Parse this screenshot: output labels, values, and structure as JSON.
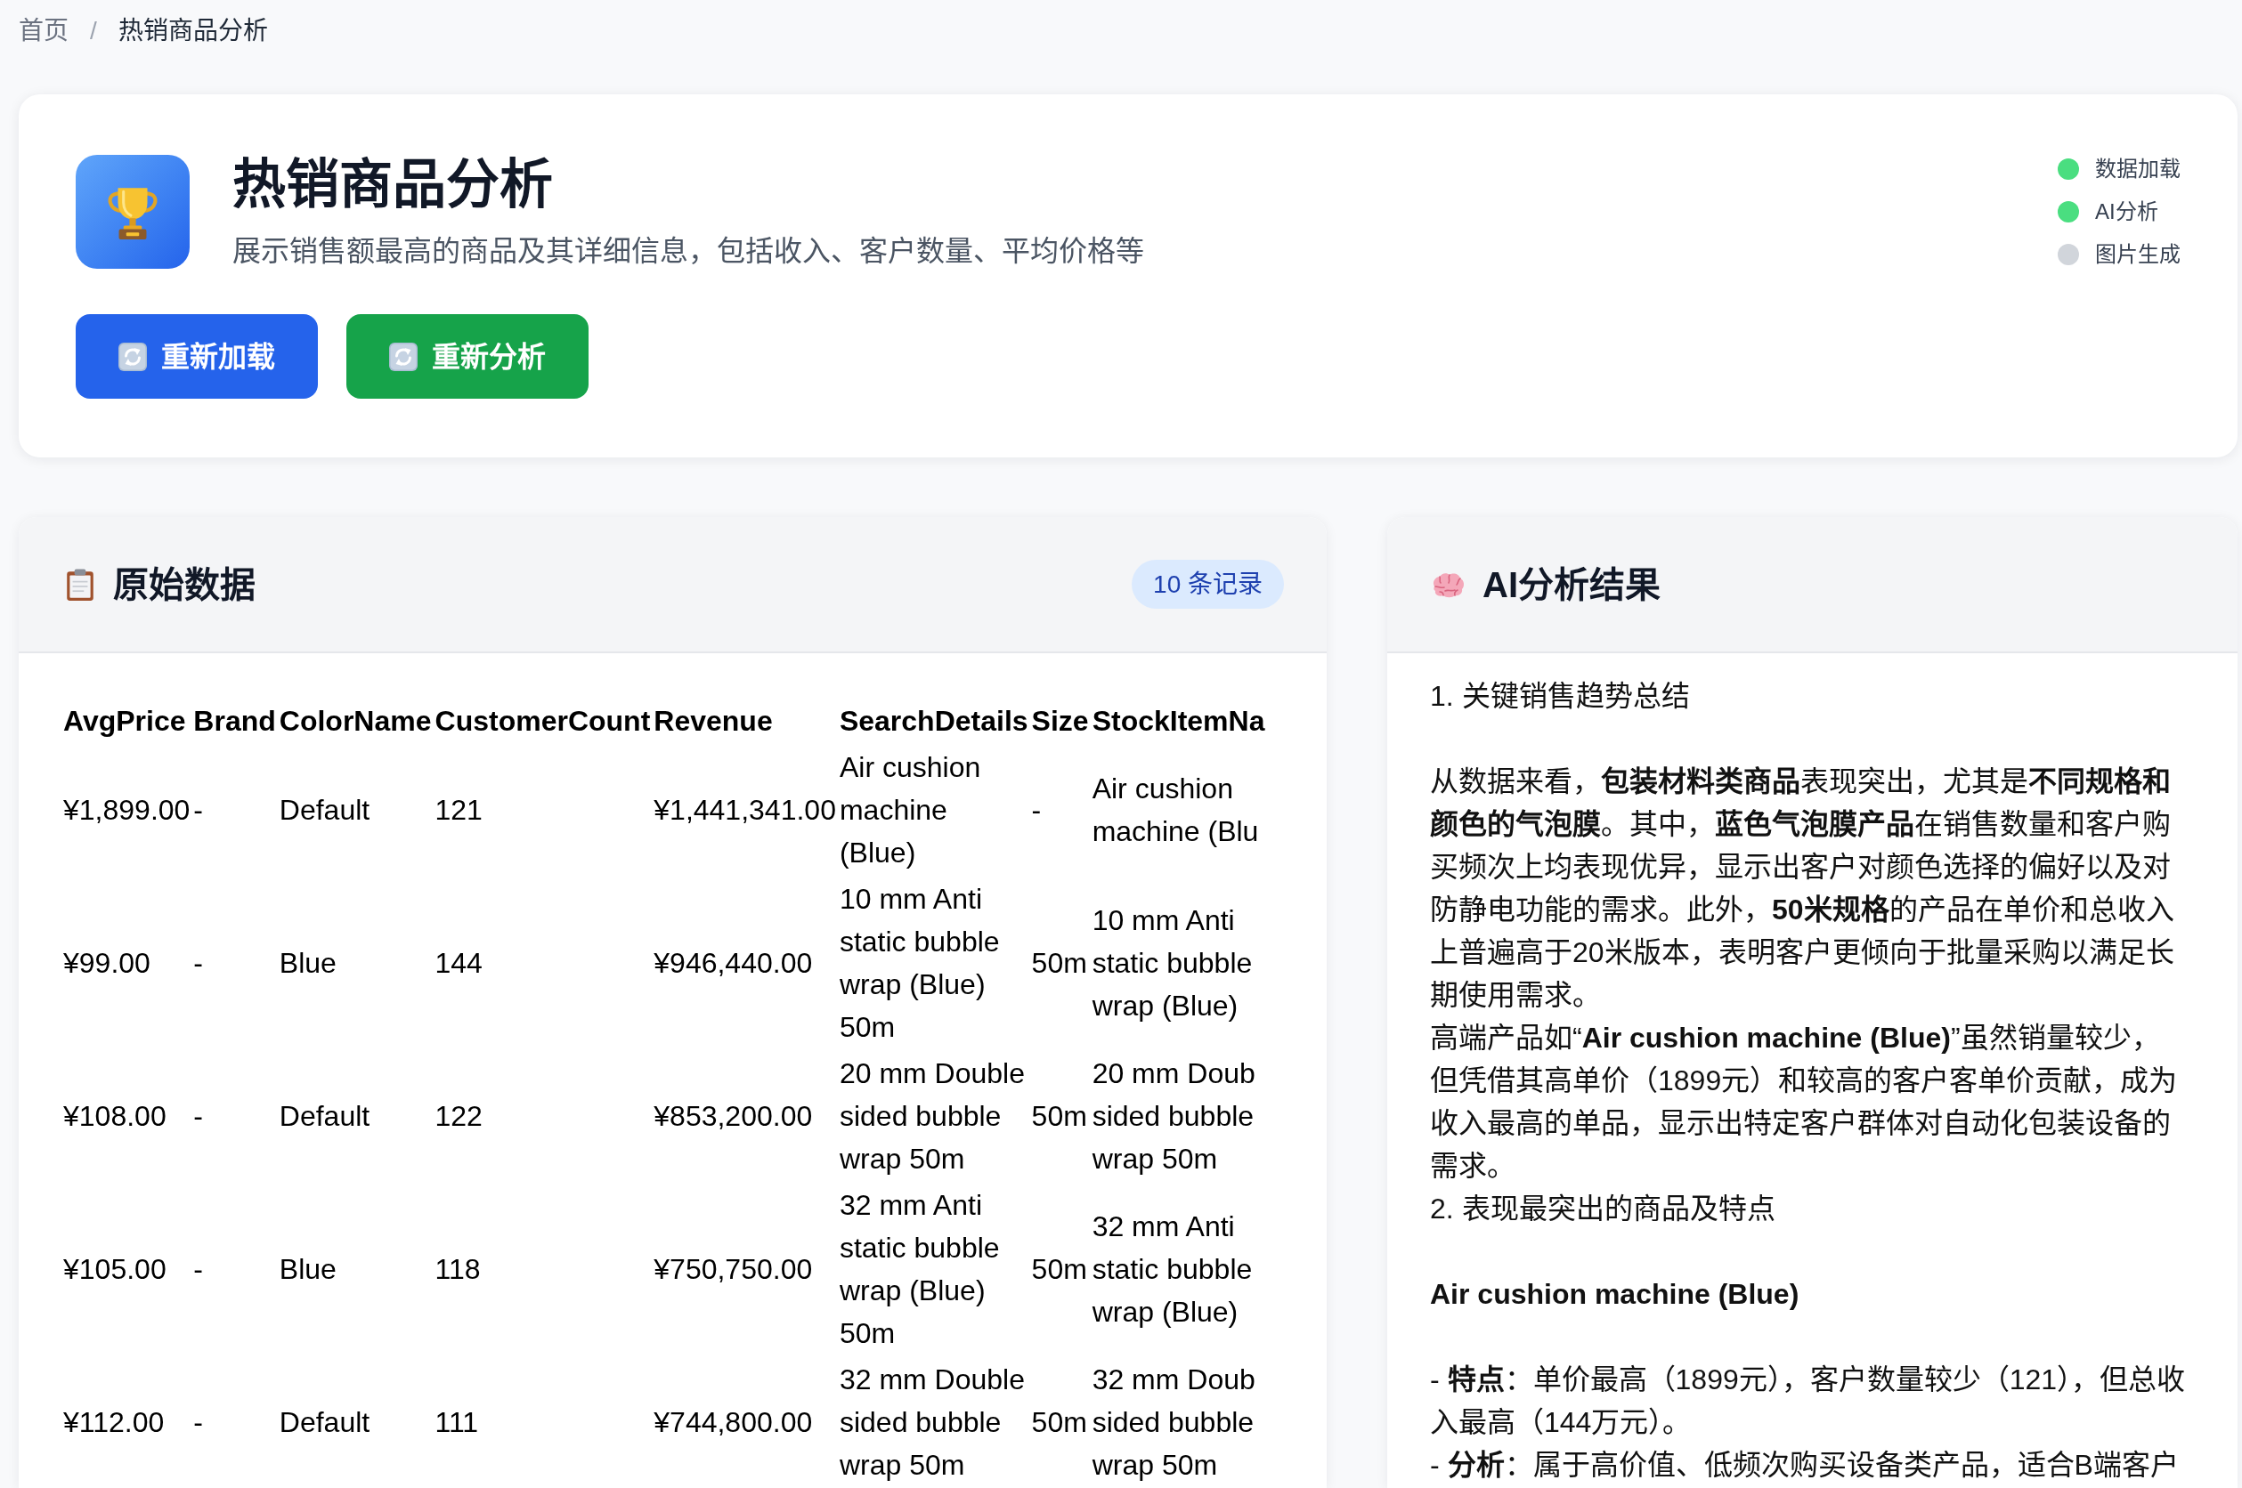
{
  "breadcrumb": {
    "separator": "/",
    "items": [
      {
        "label": "首页",
        "current": false
      },
      {
        "label": "热销商品分析",
        "current": true
      }
    ]
  },
  "header": {
    "title": "热销商品分析",
    "subtitle": "展示销售额最高的商品及其详细信息，包括收入、客户数量、平均价格等",
    "buttons": [
      {
        "label": "重新加载",
        "color": "#2563eb"
      },
      {
        "label": "重新分析",
        "color": "#16a34a"
      }
    ],
    "steps": [
      {
        "label": "数据加载",
        "color": "#4ade80"
      },
      {
        "label": "AI分析",
        "color": "#4ade80"
      },
      {
        "label": "图片生成",
        "color": "#d1d5db"
      }
    ]
  },
  "raw_data": {
    "title": "原始数据",
    "badge": "10 条记录",
    "table": {
      "columns": [
        "AvgPrice",
        "Brand",
        "ColorName",
        "CustomerCount",
        "Revenue",
        "SearchDetails",
        "Size",
        "StockItemNa"
      ],
      "rows": [
        [
          "¥1,899.00",
          "-",
          "Default",
          "121",
          "¥1,441,341.00",
          "Air cushion machine (Blue)",
          "-",
          "Air cushion machine (Blu"
        ],
        [
          "¥99.00",
          "-",
          "Blue",
          "144",
          "¥946,440.00",
          "10 mm Anti static bubble wrap (Blue) 50m",
          "50m",
          "10 mm Anti static bubble wrap (Blue)"
        ],
        [
          "¥108.00",
          "-",
          "Default",
          "122",
          "¥853,200.00",
          "20 mm Double sided bubble wrap 50m",
          "50m",
          "20 mm Doub sided bubble wrap 50m"
        ],
        [
          "¥105.00",
          "-",
          "Blue",
          "118",
          "¥750,750.00",
          "32 mm Anti static bubble wrap (Blue) 50m",
          "50m",
          "32 mm Anti static bubble wrap (Blue)"
        ],
        [
          "¥112.00",
          "-",
          "Default",
          "111",
          "¥744,800.00",
          "32 mm Double sided bubble wrap 50m",
          "50m",
          "32 mm Doub sided bubble wrap 50m"
        ]
      ]
    }
  },
  "ai_analysis": {
    "title": "AI分析结果",
    "blocks": [
      {
        "kind": "section",
        "text": "1. 关键销售趋势总结"
      },
      {
        "kind": "paragraph",
        "text": "从数据来看，**包装材料类商品**表现突出，尤其是**不同规格和颜色的气泡膜**。其中，**蓝色气泡膜产品**在销售数量和客户购买频次上均表现优异，显示出客户对颜色选择的偏好以及对防静电功能的需求。此外，**50米规格**的产品在单价和总收入上普遍高于20米版本，表明客户更倾向于批量采购以满足长期使用需求。"
      },
      {
        "kind": "paragraph",
        "text": "高端产品如“**Air cushion machine (Blue)**”虽然销量较少，但凭借其高单价（1899元）和较高的客户客单价贡献，成为收入最高的单品，显示出特定客户群体对自动化包装设备的需求。"
      },
      {
        "kind": "section",
        "text": "2. 表现最突出的商品及特点"
      },
      {
        "kind": "heading",
        "text": "Air cushion machine (Blue)"
      },
      {
        "kind": "paragraph",
        "text": "- **特点**：单价最高（1899元），客户数量较少（121），但总收入最高（144万元）。"
      },
      {
        "kind": "paragraph",
        "text": "- **分析**：属于高价值、低频次购买设备类产品，适合B端客户"
      }
    ]
  }
}
